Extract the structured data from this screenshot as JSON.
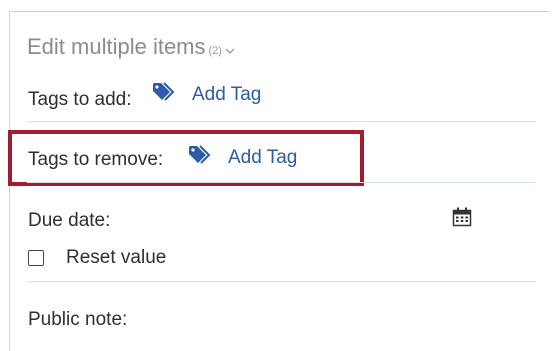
{
  "header": {
    "title": "Edit multiple items",
    "count": "(2)"
  },
  "tags_to_add": {
    "label": "Tags to add:",
    "action": "Add Tag"
  },
  "tags_to_remove": {
    "label": "Tags to remove:",
    "action": "Add Tag"
  },
  "due_date": {
    "label": "Due date:",
    "reset_label": "Reset value",
    "reset_checked": false
  },
  "public_note": {
    "label": "Public note:"
  },
  "colors": {
    "link": "#2e5aa7",
    "highlight": "#a31d2f",
    "divider": "#d9e2e2"
  },
  "icons": {
    "tag": "tag-icon",
    "calendar": "calendar-icon",
    "chevron": "chevron-down-icon"
  }
}
